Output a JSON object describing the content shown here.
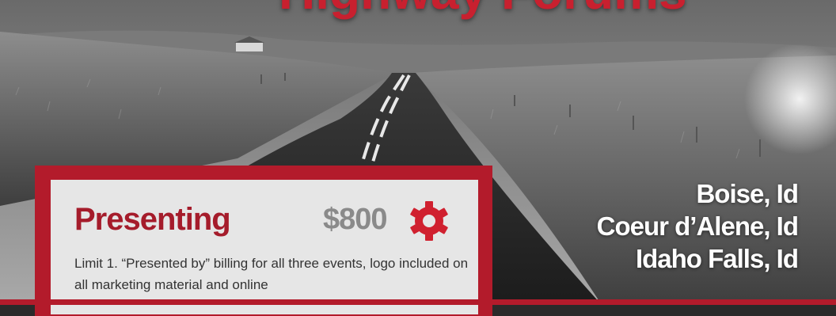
{
  "banner": {
    "title": "Highway Forums",
    "cities": [
      "Boise, Id",
      "Coeur d’Alene, Id",
      "Idaho Falls, Id"
    ]
  },
  "sponsorship": {
    "tier": "Presenting",
    "price": "$800",
    "icon": "gear-icon",
    "description": "Limit 1. “Presented by” billing for all three events, logo included on all marketing material and online"
  },
  "colors": {
    "brand_red": "#b31b2b",
    "title_red": "#c8202f",
    "price_gray": "#8a8a8a",
    "card_bg": "#e6e6e6"
  }
}
